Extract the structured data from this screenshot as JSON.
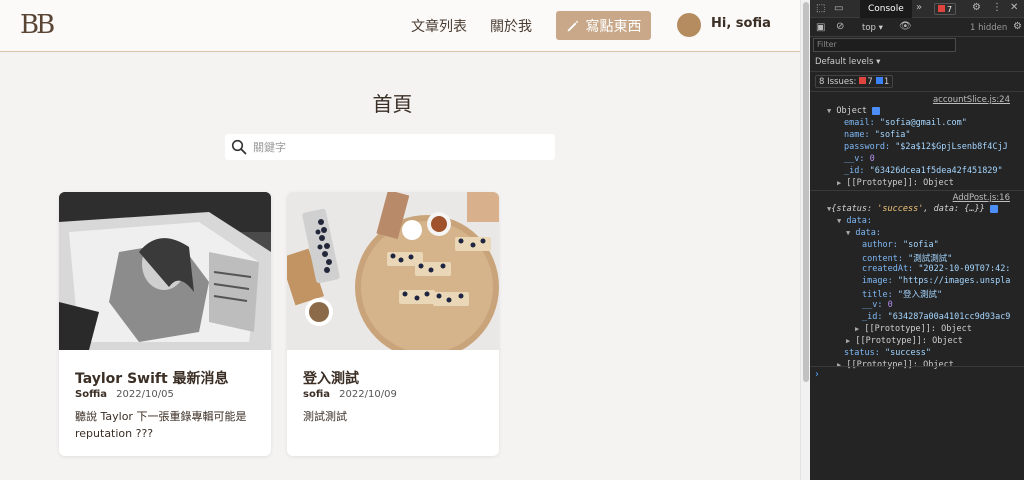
{
  "nav": {
    "logo": "BB",
    "links": [
      "文章列表",
      "關於我"
    ],
    "write_button": "寫點東西",
    "greeting": "Hi, sofia"
  },
  "main": {
    "title": "首頁",
    "search_placeholder": "關鍵字"
  },
  "posts": [
    {
      "title": "Taylor Swift 最新消息",
      "author": "Soffia",
      "date": "2022/10/05",
      "excerpt": "聽說 Taylor 下一張重錄專輯可能是 reputation ???"
    },
    {
      "title": "登入測試",
      "author": "sofia",
      "date": "2022/10/09",
      "excerpt": "測試測試"
    }
  ],
  "devtools": {
    "tab_label": "Console",
    "more": "»",
    "error_count": "7",
    "context": "top ▾",
    "hidden": "1 hidden",
    "filter_placeholder": "Filter",
    "levels": "Default levels ▾",
    "issues_label": "8 Issues:",
    "issues_errors": "7",
    "issues_info": "1",
    "log1": {
      "source": "accountSlice.js:24",
      "header": "Object",
      "email_key": "email:",
      "email_val": "\"sofia@gmail.com\"",
      "name_key": "name:",
      "name_val": "\"sofia\"",
      "password_key": "password:",
      "password_val": "\"$2a$12$GpjLsenb8f4CjJ",
      "v_key": "__v:",
      "v_val": "0",
      "id_key": "_id:",
      "id_val": "\"63426dcea1f5dea42f451829\"",
      "proto": "[[Prototype]]: Object"
    },
    "log2": {
      "source": "AddPost.js:16",
      "header_pre": "{status: ",
      "header_status": "'success'",
      "header_post": ", data: {…}}",
      "data_key": "data:",
      "data_inner_key": "data:",
      "author_key": "author:",
      "author_val": "\"sofia\"",
      "content_key": "content:",
      "content_val": "\"測試測試\"",
      "createdAt_key": "createdAt:",
      "createdAt_val": "\"2022-10-09T07:42:",
      "image_key": "image:",
      "image_val": "\"https://images.unspla",
      "title_key": "title:",
      "title_val": "\"登入測試\"",
      "v_key": "__v:",
      "v_val": "0",
      "id_key": "_id:",
      "id_val": "\"634287a00a4101cc9d93ac9",
      "proto_inner": "[[Prototype]]: Object",
      "proto_data": "[[Prototype]]: Object",
      "status_key": "status:",
      "status_val": "\"success\"",
      "proto_outer": "[[Prototype]]: Object"
    },
    "prompt": "›"
  },
  "colors": {
    "accent": "#c8a889",
    "brand_text": "#3b2e25",
    "avatar": "#b58c5f"
  }
}
